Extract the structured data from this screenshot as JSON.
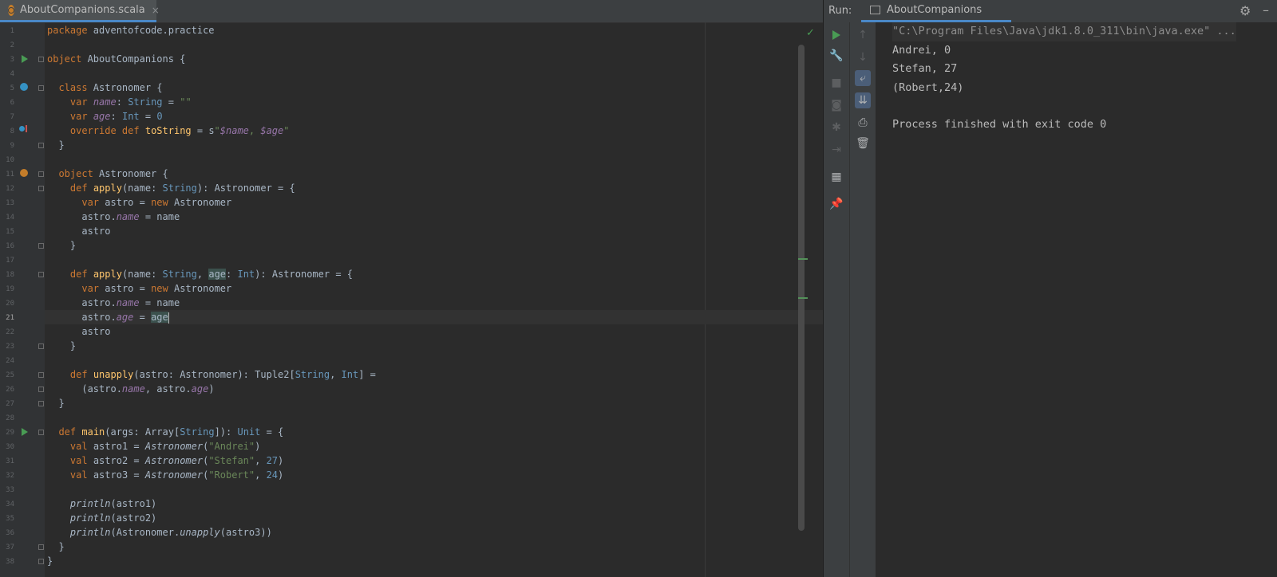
{
  "editor": {
    "tab_label": "AboutCompanions.scala",
    "tab_close": "×",
    "current_line": "21",
    "line_numbers": [
      "1",
      "2",
      "3",
      "4",
      "5",
      "6",
      "7",
      "8",
      "9",
      "10",
      "11",
      "12",
      "13",
      "14",
      "15",
      "16",
      "17",
      "18",
      "19",
      "20",
      "21",
      "22",
      "23",
      "24",
      "25",
      "26",
      "27",
      "28",
      "29",
      "30",
      "31",
      "32",
      "33",
      "34",
      "35",
      "36",
      "37",
      "38"
    ]
  },
  "run": {
    "label": "Run:",
    "tab_label": "AboutCompanions",
    "console": {
      "command": "\"C:\\Program Files\\Java\\jdk1.8.0_311\\bin\\java.exe\" ...",
      "output": [
        "Andrei, 0",
        "Stefan, 27",
        "(Robert,24)",
        "",
        "Process finished with exit code 0"
      ]
    }
  },
  "icons": {
    "gutter_run": "run-gutter-icon",
    "settings": "gear-icon",
    "hide": "minimize-icon"
  },
  "colors": {
    "accent": "#4a88c7",
    "run_green": "#499c54",
    "keyword": "#cc7832",
    "string": "#6a8759"
  }
}
